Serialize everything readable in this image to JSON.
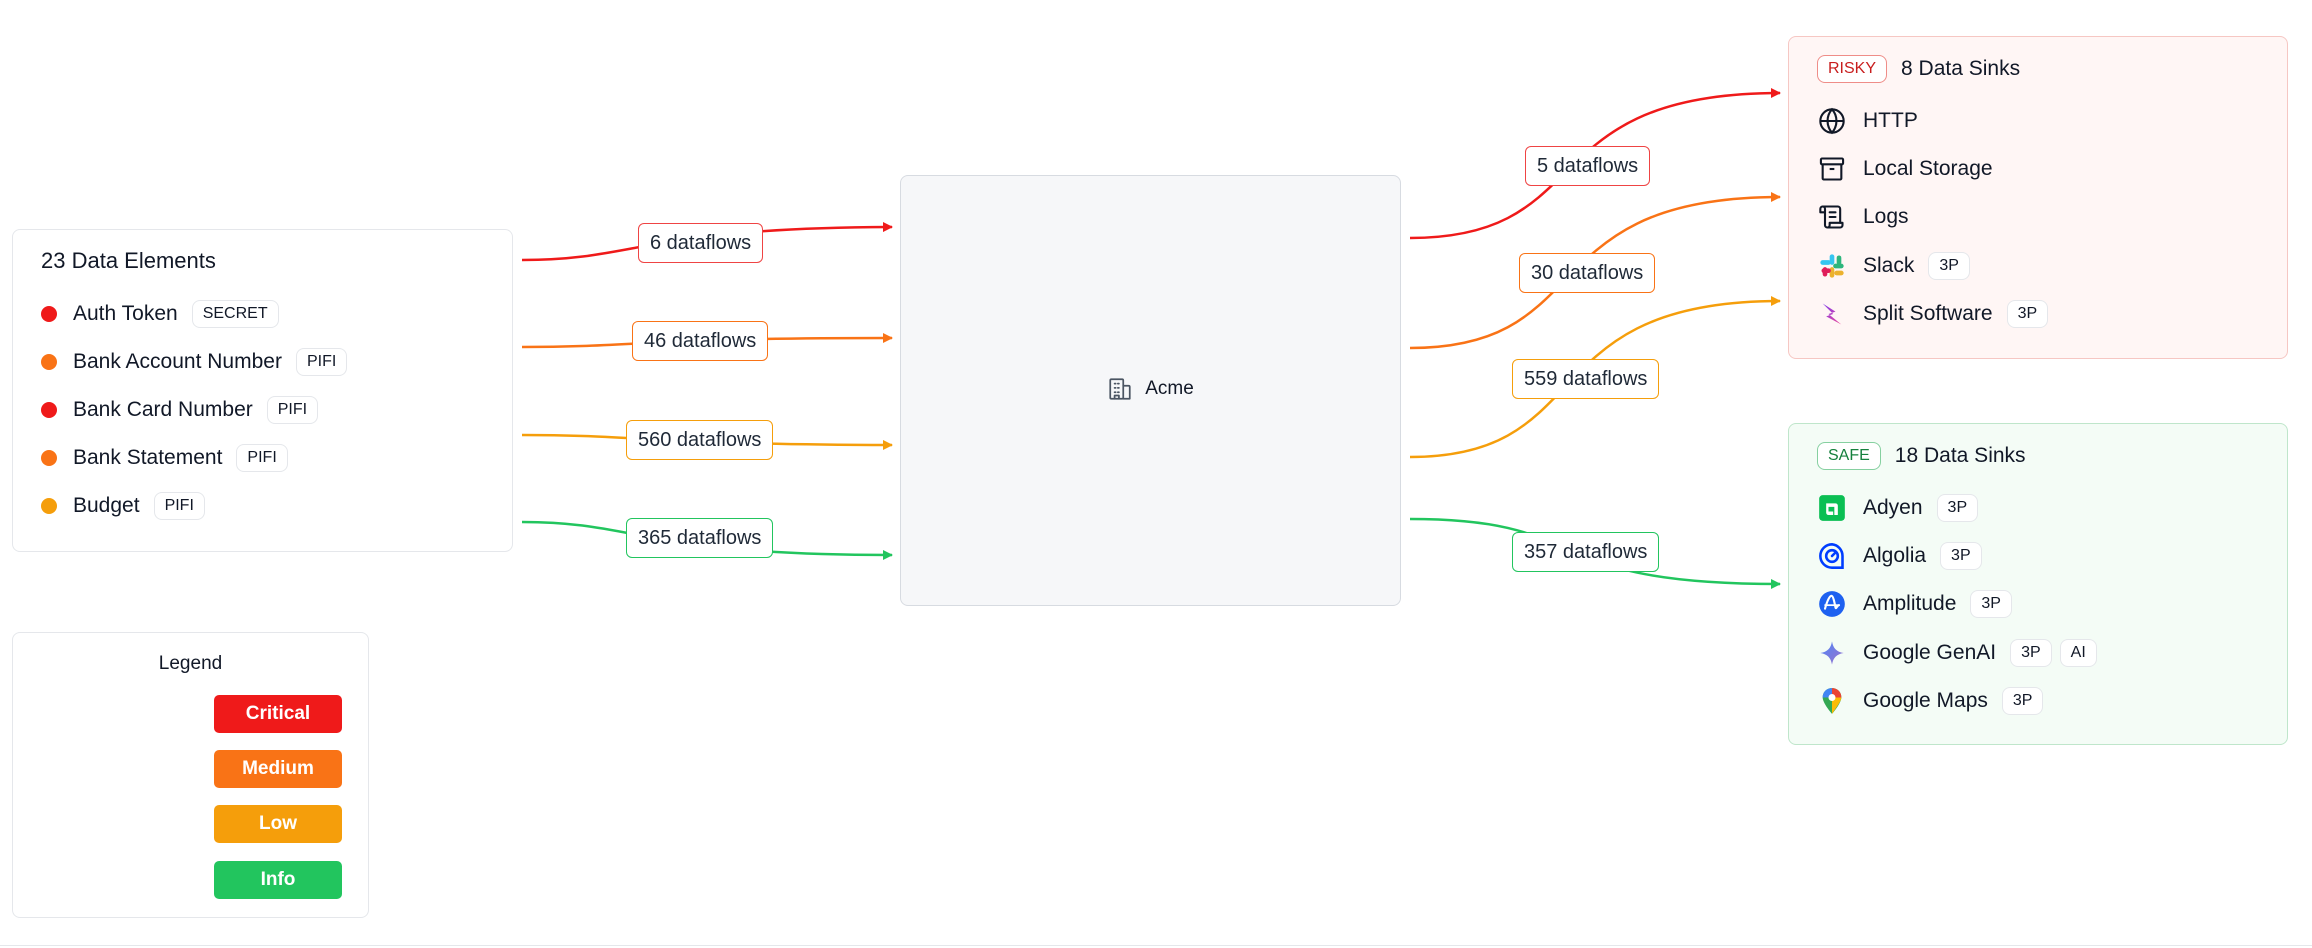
{
  "colors": {
    "critical": "#ef1a1a",
    "medium": "#f97316",
    "low": "#f59e0b",
    "info": "#22c55e"
  },
  "elements": {
    "title": "23 Data Elements",
    "items": [
      {
        "label": "Auth Token",
        "tag": "SECRET",
        "severity": "critical"
      },
      {
        "label": "Bank Account Number",
        "tag": "PIFI",
        "severity": "medium"
      },
      {
        "label": "Bank Card Number",
        "tag": "PIFI",
        "severity": "critical"
      },
      {
        "label": "Bank Statement",
        "tag": "PIFI",
        "severity": "medium"
      },
      {
        "label": "Budget",
        "tag": "PIFI",
        "severity": "low"
      }
    ]
  },
  "inbound_flows": [
    {
      "label": "6 dataflows",
      "severity": "critical"
    },
    {
      "label": "46 dataflows",
      "severity": "medium"
    },
    {
      "label": "560 dataflows",
      "severity": "low"
    },
    {
      "label": "365 dataflows",
      "severity": "info"
    }
  ],
  "center": {
    "label": "Acme",
    "icon": "building-icon"
  },
  "outbound_flows": [
    {
      "label": "5 dataflows",
      "severity": "critical"
    },
    {
      "label": "30 dataflows",
      "severity": "medium"
    },
    {
      "label": "559 dataflows",
      "severity": "low"
    },
    {
      "label": "357 dataflows",
      "severity": "info"
    }
  ],
  "risky": {
    "badge": "RISKY",
    "title": "8 Data Sinks",
    "items": [
      {
        "label": "HTTP",
        "icon": "globe-icon",
        "tags": []
      },
      {
        "label": "Local Storage",
        "icon": "archive-icon",
        "tags": []
      },
      {
        "label": "Logs",
        "icon": "scroll-icon",
        "tags": []
      },
      {
        "label": "Slack",
        "icon": "slack-icon",
        "tags": [
          "3P"
        ]
      },
      {
        "label": "Split Software",
        "icon": "split-icon",
        "tags": [
          "3P"
        ]
      }
    ]
  },
  "safe": {
    "badge": "SAFE",
    "title": "18 Data Sinks",
    "items": [
      {
        "label": "Adyen",
        "icon": "adyen-icon",
        "tags": [
          "3P"
        ]
      },
      {
        "label": "Algolia",
        "icon": "algolia-icon",
        "tags": [
          "3P"
        ]
      },
      {
        "label": "Amplitude",
        "icon": "amplitude-icon",
        "tags": [
          "3P"
        ]
      },
      {
        "label": "Google GenAI",
        "icon": "sparkle-icon",
        "tags": [
          "3P",
          "AI"
        ]
      },
      {
        "label": "Google Maps",
        "icon": "map-pin-icon",
        "tags": [
          "3P"
        ]
      }
    ]
  },
  "legend": {
    "title": "Legend",
    "items": [
      {
        "label": "Critical",
        "severity": "critical"
      },
      {
        "label": "Medium",
        "severity": "medium"
      },
      {
        "label": "Low",
        "severity": "low"
      },
      {
        "label": "Info",
        "severity": "info"
      }
    ]
  }
}
